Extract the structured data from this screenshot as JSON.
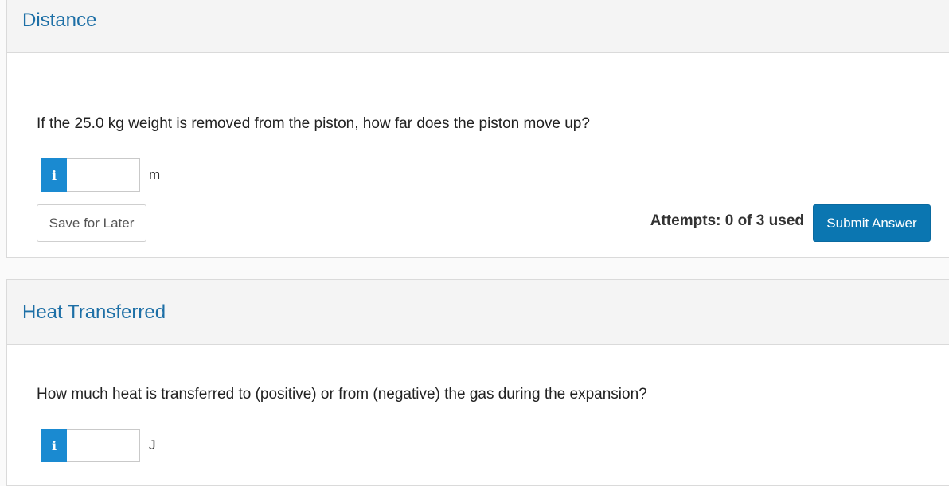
{
  "sections": [
    {
      "title": "Distance",
      "question": "If the 25.0 kg weight is removed from the piston, how far does the piston move up?",
      "info_icon": "i",
      "answer_value": "",
      "unit": "m",
      "save_label": "Save for Later",
      "attempts_text": "Attempts: 0 of 3 used",
      "submit_label": "Submit Answer"
    },
    {
      "title": "Heat Transferred",
      "question": "How much heat is transferred to (positive) or from (negative) the gas during the expansion?",
      "info_icon": "i",
      "answer_value": "",
      "unit": "J"
    }
  ],
  "colors": {
    "title": "#1d6fa6",
    "info_button": "#1a8ad1",
    "submit_button": "#0b76b1"
  }
}
